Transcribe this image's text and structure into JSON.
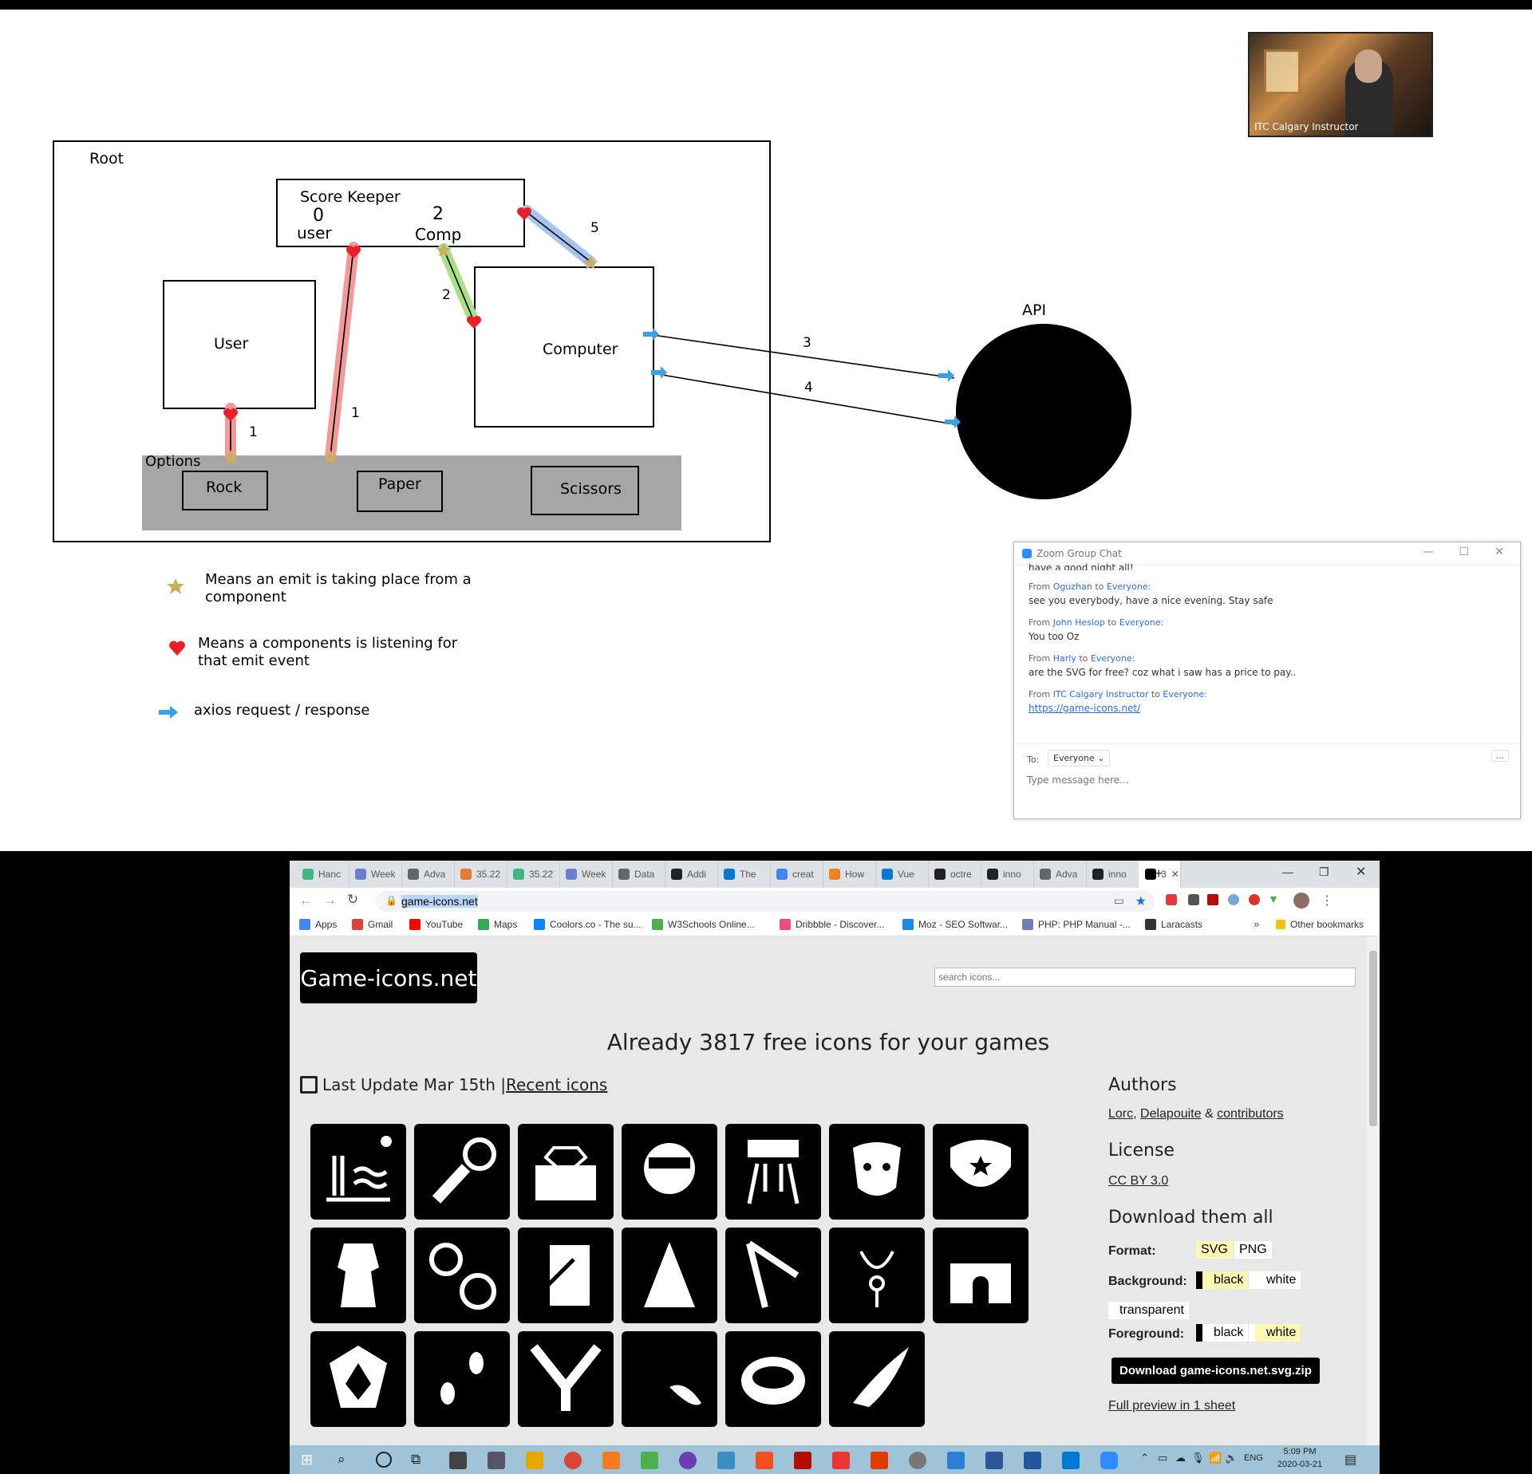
{
  "whiteboard": {
    "root_label": "Root",
    "score_keeper": {
      "title": "Score  Keeper",
      "user_score": "0",
      "user_label": "user",
      "comp_score": "2",
      "comp_label": "Comp"
    },
    "user_box": "User",
    "computer_box": "Computer",
    "options": {
      "label": "Options",
      "rock": "Rock",
      "paper": "Paper",
      "scissors": "Scissors"
    },
    "api_label": "API",
    "arrow_numbers": {
      "n1a": "1",
      "n1b": "1",
      "n2": "2",
      "n3": "3",
      "n4": "4",
      "n5": "5"
    },
    "legend": {
      "star_text": "Means an emit is taking place from a component",
      "heart_text": "Means a components is listening for that emit event",
      "arrow_text": "axios request / response"
    },
    "colors": {
      "star": "#c8b060",
      "heart": "#e8202a",
      "axios_arrow": "#3ba0e8",
      "red_trail": "#f29a9a",
      "green_trail": "#a8e08a",
      "blue_trail": "#a8c4ee",
      "options_bg": "#a6a6a6"
    }
  },
  "video": {
    "name": "ITC Calgary Instructor"
  },
  "chat": {
    "title": "Zoom Group Chat",
    "truncated_line": "have a good night all!",
    "messages": [
      {
        "from_prefix": "From ",
        "sender": "Oguzhan",
        "to_text": " to ",
        "recipient": "Everyone:",
        "text": "see you everybody, have a nice evening. Stay safe"
      },
      {
        "from_prefix": "From ",
        "sender": "John Heslop",
        "to_text": " to ",
        "recipient": "Everyone:",
        "text": "You too Oz"
      },
      {
        "from_prefix": "From ",
        "sender": "Harly",
        "to_text": " to ",
        "recipient": "Everyone:",
        "text": "are the SVG for free? coz what i saw has a price to pay.."
      },
      {
        "from_prefix": "From ",
        "sender": "ITC Calgary Instructor",
        "to_text": " to ",
        "recipient": "Everyone:",
        "text": "https://game-icons.net/"
      }
    ],
    "to_label": "To:",
    "to_value": "Everyone",
    "input_placeholder": "Type message here...",
    "more_label": "..."
  },
  "browser": {
    "tabs": [
      "Hanc",
      "Week",
      "Adva",
      "35.22",
      "35.22",
      "Week",
      "Data",
      "Addi",
      "The",
      "creat",
      "How",
      "Vue",
      "octre",
      "inno",
      "Adva",
      "inno",
      "3"
    ],
    "new_tab": "+",
    "url": "game-icons.net",
    "bookmarks": [
      "Apps",
      "Gmail",
      "YouTube",
      "Maps",
      "Coolors.co - The su...",
      "W3Schools Online...",
      "Dribbble - Discover...",
      "Moz - SEO Softwar...",
      "PHP: PHP Manual -...",
      "Laracasts"
    ],
    "bookmarks_more": "»",
    "other_bookmarks": "Other bookmarks"
  },
  "site": {
    "logo": "Game-icons.net",
    "search_placeholder": "search icons...",
    "headline": "Already 3817 free icons for your games",
    "last_update": "Last Update Mar 15th | ",
    "recent_icons": "Recent icons",
    "authors_title": "Authors",
    "author1": "Lorc",
    "sep1": ", ",
    "author2": "Delapouite",
    "amp": " & ",
    "contributors": "contributors",
    "license_title": "License",
    "license": "CC BY 3.0",
    "download_title": "Download them all",
    "format_label": "Format:",
    "format_svg": "SVG",
    "format_png": "PNG",
    "background_label": "Background:",
    "bg_black": "black",
    "bg_white": "white",
    "bg_transparent": "transparent",
    "foreground_label": "Foreground:",
    "fg_black": "black",
    "fg_white": "white",
    "download_button": "Download game-icons.net.svg.zip",
    "full_preview": "Full preview in 1 sheet",
    "icons": [
      "beach",
      "sword-grapple",
      "jewel-box",
      "aviator",
      "robot-claw",
      "dog",
      "soldier-hat",
      "dress",
      "watch",
      "quill-scroll",
      "tower",
      "prism",
      "key-necklace",
      "castle",
      "shield",
      "footprints",
      "tree-split",
      "broom",
      "pearl-shell",
      "winged-arm"
    ]
  },
  "taskbar": {
    "time": "5:09 PM",
    "date": "2020-03-21",
    "lang": "ENG"
  }
}
